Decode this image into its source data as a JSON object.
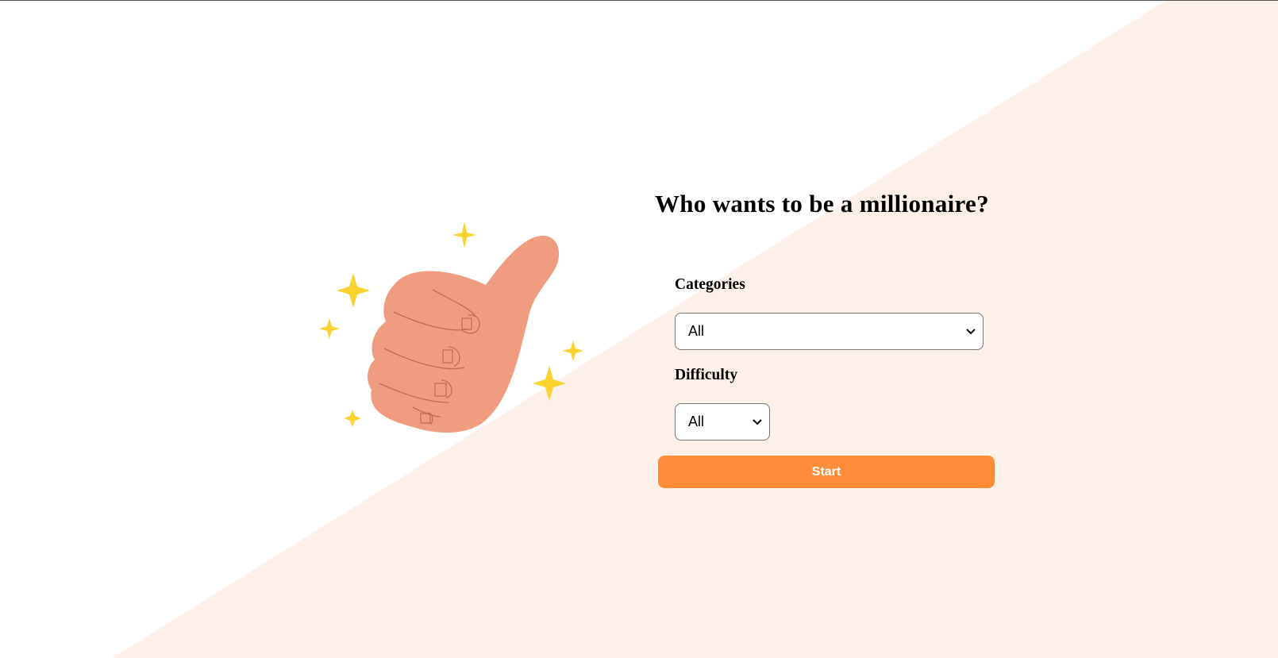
{
  "header": {
    "title": "Who wants to be a millionaire?"
  },
  "form": {
    "categories": {
      "label": "Categories",
      "selected": "All"
    },
    "difficulty": {
      "label": "Difficulty",
      "selected": "All"
    },
    "start_label": "Start"
  },
  "illustration": {
    "icon": "thumbs-up-icon",
    "sparkle_icon": "sparkle-icon"
  },
  "colors": {
    "background_tint": "#fdf0e9",
    "accent": "#ff8c38",
    "skin": "#ef9c80",
    "skin_line": "#c86a52",
    "sparkle": "#fbd22e"
  }
}
